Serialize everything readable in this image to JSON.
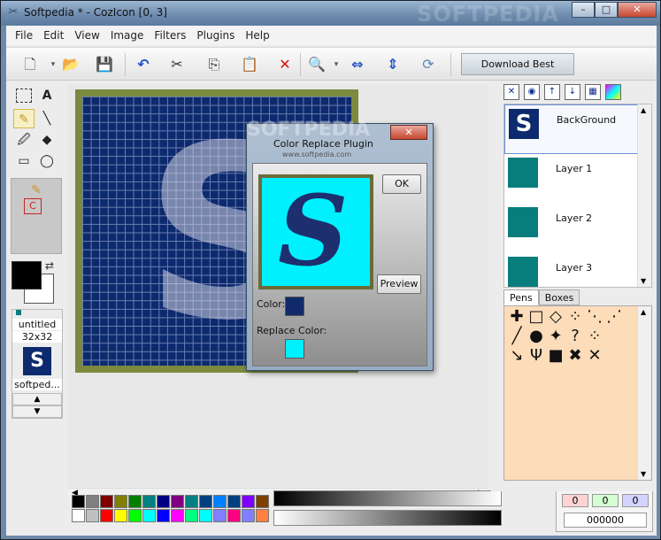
{
  "window": {
    "title": "Softpedia * - CozIcon [0, 3]",
    "brand_watermark": "SOFTPEDIA",
    "controls": {
      "minimize": "–",
      "maximize": "□",
      "close": "✕"
    }
  },
  "menu": [
    "File",
    "Edit",
    "View",
    "Image",
    "Filters",
    "Plugins",
    "Help"
  ],
  "toolbar": {
    "download_label": "Download Best Products"
  },
  "toolbox": {
    "tools": [
      "select-rect",
      "text",
      "pencil",
      "line",
      "eyedropper",
      "fill",
      "rectangle",
      "ellipse"
    ]
  },
  "document": {
    "size_name": "untitled",
    "size": "32x32",
    "thumb_name": "softped..."
  },
  "layers": [
    {
      "name": "BackGround",
      "selected": true,
      "thumb": "S"
    },
    {
      "name": "Layer 1",
      "selected": false,
      "thumb": ""
    },
    {
      "name": "Layer 2",
      "selected": false,
      "thumb": ""
    },
    {
      "name": "Layer 3",
      "selected": false,
      "thumb": ""
    }
  ],
  "tabs": [
    {
      "label": "Pens",
      "active": true
    },
    {
      "label": "Boxes",
      "active": false
    }
  ],
  "rgb": {
    "r": "0",
    "g": "0",
    "b": "0",
    "hex": "000000"
  },
  "dialog": {
    "title": "Color Replace Plugin",
    "watermark": "SOFTPEDIA",
    "watermark_url": "www.softpedia.com",
    "ok_label": "OK",
    "preview_label": "Preview",
    "color_label": "Color:",
    "replace_label": "Replace Color:",
    "preview_glyph": "S",
    "color_value": "#112a6c",
    "replace_value": "#00f0ff"
  },
  "palette_colors": [
    "#000000",
    "#808080",
    "#800000",
    "#808000",
    "#008000",
    "#008080",
    "#000080",
    "#800080",
    "#008080",
    "#004080",
    "#0080ff",
    "#004080",
    "#8000ff",
    "#804000",
    "#ffffff",
    "#c0c0c0",
    "#ff0000",
    "#ffff00",
    "#00ff00",
    "#00ffff",
    "#0000ff",
    "#ff00ff",
    "#00ff80",
    "#00ffff",
    "#8080ff",
    "#ff0080",
    "#8080ff",
    "#ff8040"
  ]
}
